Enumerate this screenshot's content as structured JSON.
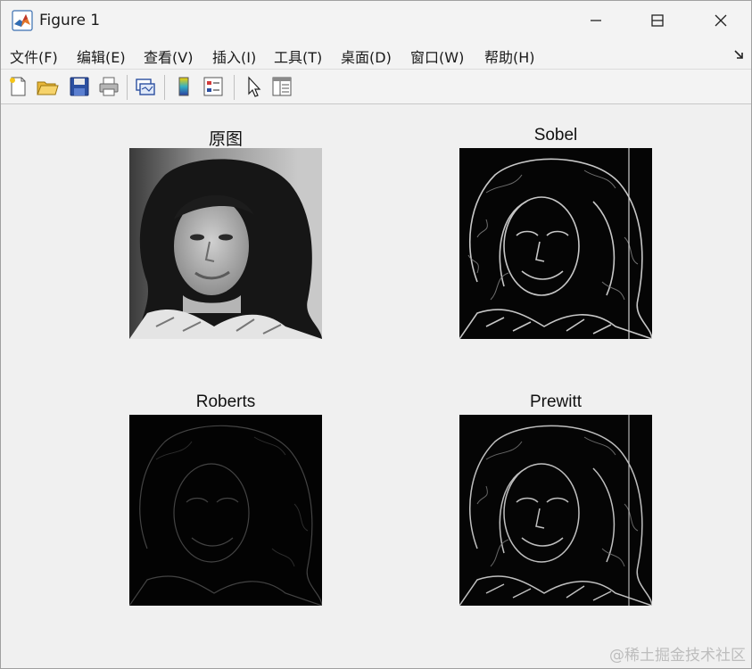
{
  "window": {
    "title": "Figure 1",
    "controls": [
      "minimize",
      "maximize",
      "close"
    ]
  },
  "menubar": {
    "items": [
      "文件(F)",
      "编辑(E)",
      "查看(V)",
      "插入(I)",
      "工具(T)",
      "桌面(D)",
      "窗口(W)",
      "帮助(H)"
    ]
  },
  "toolbar": {
    "buttons": [
      "new-figure-icon",
      "open-file-icon",
      "save-icon",
      "print-icon",
      "link-plot-icon",
      "colorbar-icon",
      "legend-icon",
      "pointer-icon",
      "property-editor-icon"
    ]
  },
  "plots": {
    "original": {
      "title": "原图"
    },
    "sobel": {
      "title": "Sobel"
    },
    "roberts": {
      "title": "Roberts"
    },
    "prewitt": {
      "title": "Prewitt"
    }
  },
  "watermark": "@稀土掘金技术社区"
}
